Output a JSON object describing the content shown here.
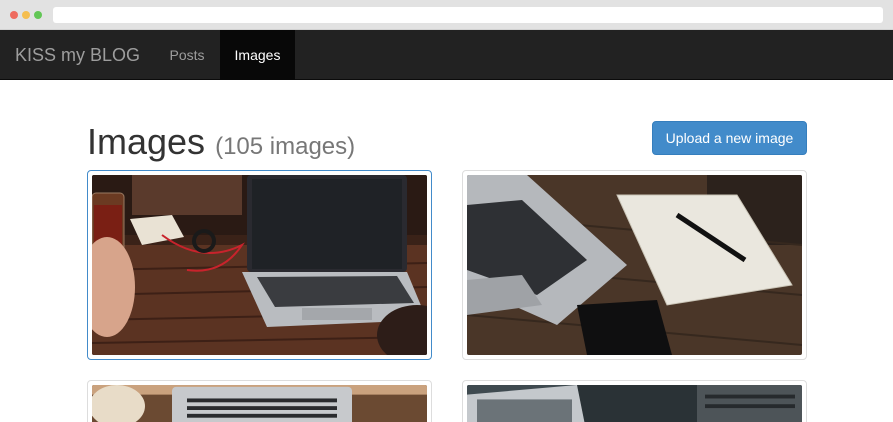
{
  "navbar": {
    "brand": "KISS my BLOG",
    "links": [
      {
        "label": "Posts",
        "active": false
      },
      {
        "label": "Images",
        "active": true
      }
    ]
  },
  "header": {
    "title": "Images",
    "count": "(105 images)",
    "upload_label": "Upload a new image"
  },
  "colors": {
    "navbar_bg": "#222222",
    "active_tab_bg": "#080808",
    "primary_button": "#428bca",
    "selected_border": "#428bca"
  },
  "gallery": {
    "images": [
      {
        "subject": "laptop-with-headphones-and-jar-on-wooden-table",
        "selected": true
      },
      {
        "subject": "laptop-with-notebook-and-pen-on-wooden-table",
        "selected": false
      },
      {
        "subject": "laptop-keyboard-on-wooden-table",
        "selected": false
      },
      {
        "subject": "laptop-with-glass-on-dark-table",
        "selected": false
      }
    ]
  }
}
